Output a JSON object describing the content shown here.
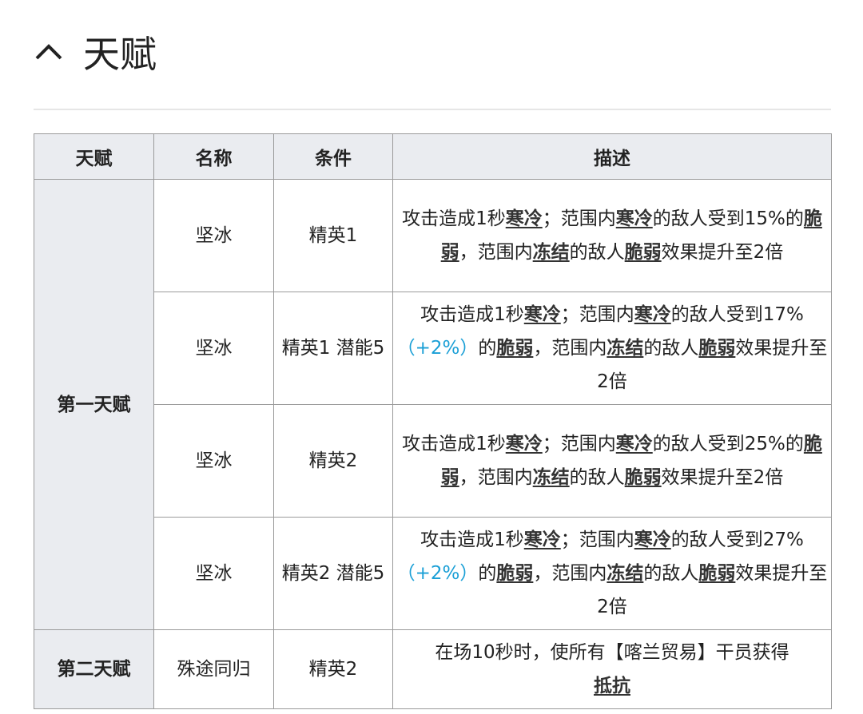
{
  "header": {
    "title": "天赋",
    "toggle_icon": "chevron-up-icon"
  },
  "table": {
    "headers": [
      "天赋",
      "名称",
      "条件",
      "描述"
    ],
    "groups": [
      {
        "talent": "第一天赋",
        "rows": [
          {
            "name": "坚冰",
            "condition": "精英1",
            "desc": [
              "攻击造成1秒",
              "寒冷",
              "；范围内",
              "寒冷",
              "的敌人受到15%的",
              "脆弱",
              "，范围内",
              "冻结",
              "的敌人",
              "脆弱",
              "效果提升至2倍"
            ]
          },
          {
            "name": "坚冰",
            "condition": "精英1 潜能5",
            "desc": [
              "攻击造成1秒",
              "寒冷",
              "；范围内",
              "寒冷",
              "的敌人受到17%",
              "（+2%）",
              "的",
              "脆弱",
              "，范围内",
              "冻结",
              "的敌人",
              "脆弱",
              "效果提升至2倍"
            ]
          },
          {
            "name": "坚冰",
            "condition": "精英2",
            "desc": [
              "攻击造成1秒",
              "寒冷",
              "；范围内",
              "寒冷",
              "的敌人受到25%的",
              "脆弱",
              "，范围内",
              "冻结",
              "的敌人",
              "脆弱",
              "效果提升至2倍"
            ]
          },
          {
            "name": "坚冰",
            "condition": "精英2 潜能5",
            "desc": [
              "攻击造成1秒",
              "寒冷",
              "；范围内",
              "寒冷",
              "的敌人受到27%",
              "（+2%）",
              "的",
              "脆弱",
              "，范围内",
              "冻结",
              "的敌人",
              "脆弱",
              "效果提升至2倍"
            ]
          }
        ]
      },
      {
        "talent": "第二天赋",
        "rows": [
          {
            "name": "殊途同归",
            "condition": "精英2",
            "desc": [
              "在场10秒时，使所有【喀兰贸易】干员获得",
              "抵抗"
            ]
          }
        ]
      }
    ]
  }
}
